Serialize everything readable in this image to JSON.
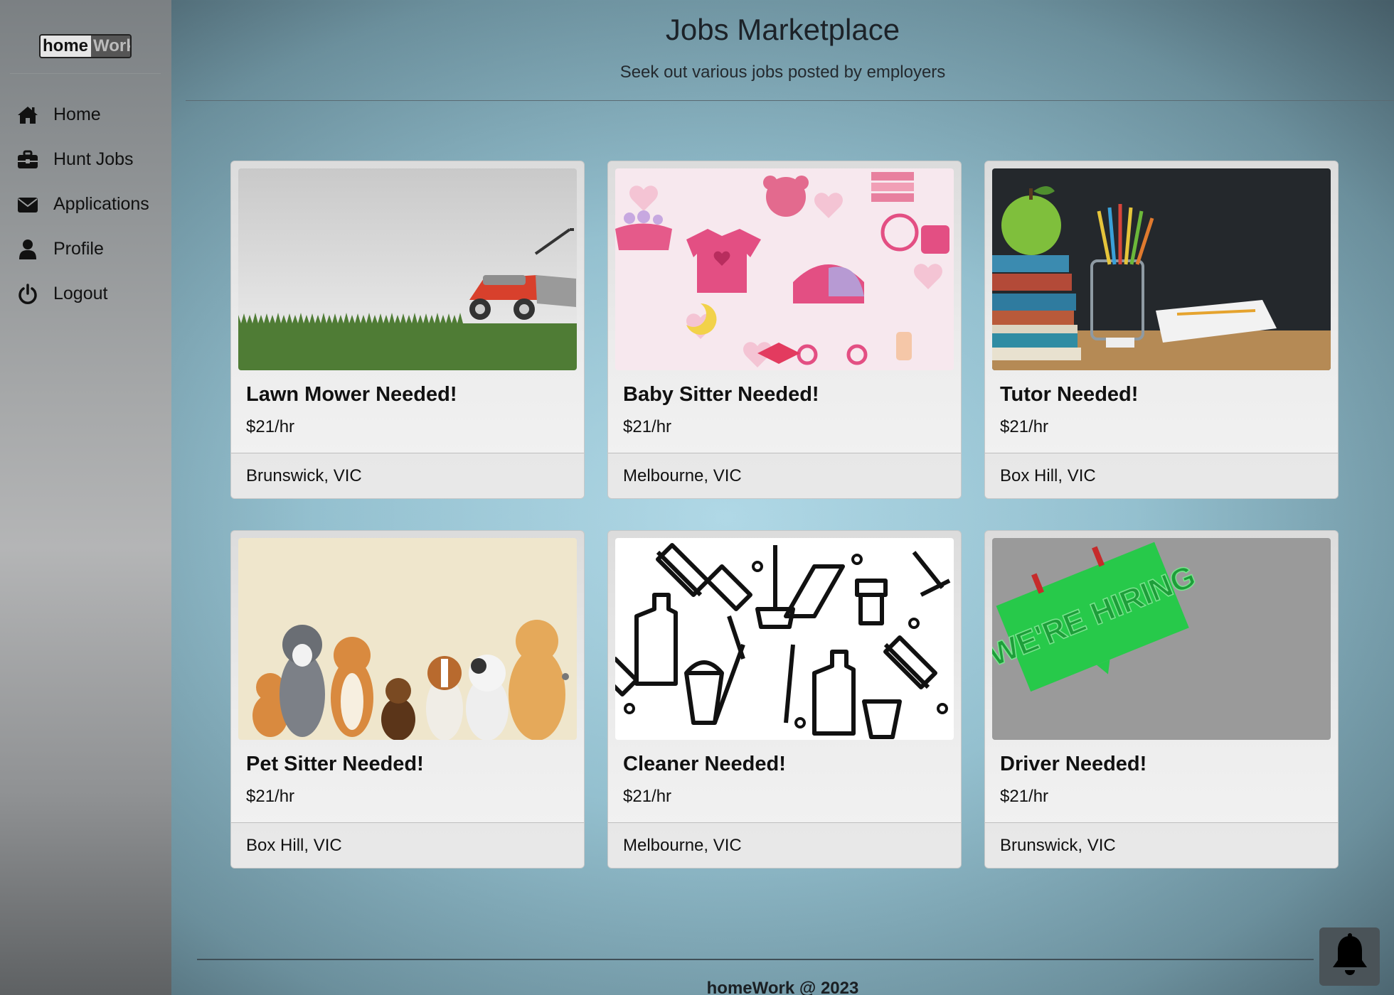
{
  "app": {
    "logo_part1": "home",
    "logo_part2": "Work"
  },
  "sidebar": {
    "items": [
      {
        "label": "Home",
        "icon": "home-icon"
      },
      {
        "label": "Hunt Jobs",
        "icon": "briefcase-icon"
      },
      {
        "label": "Applications",
        "icon": "envelope-icon"
      },
      {
        "label": "Profile",
        "icon": "user-icon"
      },
      {
        "label": "Logout",
        "icon": "power-icon"
      }
    ]
  },
  "header": {
    "title": "Jobs Marketplace",
    "subtitle": "Seek out various jobs posted by employers"
  },
  "jobs": [
    {
      "title": "Lawn Mower Needed!",
      "rate": "$21/hr",
      "location": "Brunswick, VIC",
      "image": "lawn-mower-image"
    },
    {
      "title": "Baby Sitter Needed!",
      "rate": "$21/hr",
      "location": "Melbourne, VIC",
      "image": "baby-pattern-image"
    },
    {
      "title": "Tutor Needed!",
      "rate": "$21/hr",
      "location": "Box Hill, VIC",
      "image": "books-apple-image"
    },
    {
      "title": "Pet Sitter Needed!",
      "rate": "$21/hr",
      "location": "Box Hill, VIC",
      "image": "dogs-image"
    },
    {
      "title": "Cleaner Needed!",
      "rate": "$21/hr",
      "location": "Melbourne, VIC",
      "image": "cleaning-pattern-image"
    },
    {
      "title": "Driver Needed!",
      "rate": "$21/hr",
      "location": "Brunswick, VIC",
      "image": "hiring-sign-image"
    }
  ],
  "footer": {
    "text": "homeWork @ 2023"
  },
  "notification": {
    "icon": "bell-icon"
  },
  "hiring_sign_text": "WE'RE HIRING"
}
